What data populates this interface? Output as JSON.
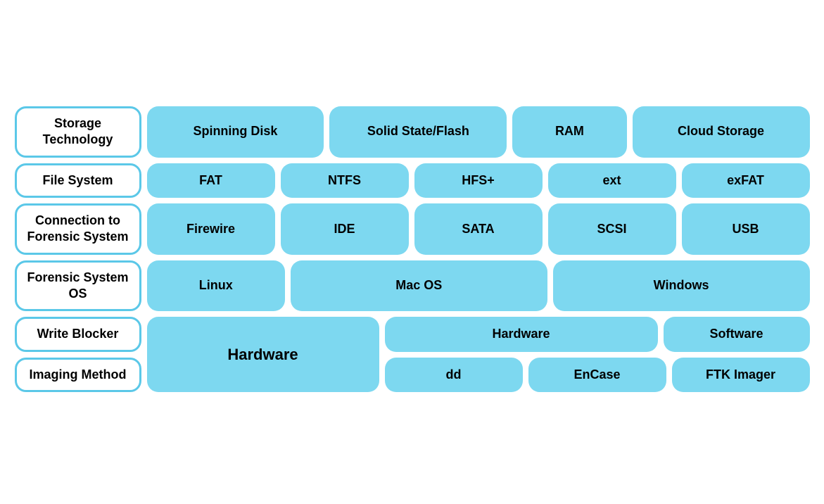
{
  "rows": [
    {
      "id": "row1",
      "label": "Storage Technology",
      "items": [
        "Spinning Disk",
        "Solid State/Flash",
        "RAM",
        "Cloud Storage"
      ]
    },
    {
      "id": "row2",
      "label": "File System",
      "items": [
        "FAT",
        "NTFS",
        "HFS+",
        "ext",
        "exFAT"
      ]
    },
    {
      "id": "row3",
      "label": "Connection to Forensic System",
      "items": [
        "Firewire",
        "IDE",
        "SATA",
        "SCSI",
        "USB"
      ]
    },
    {
      "id": "row4",
      "label": "Forensic System OS",
      "items": [
        "Linux",
        "Mac OS",
        "Windows"
      ]
    }
  ],
  "bottom": {
    "left_label_top": "Write Blocker",
    "left_label_bottom": "Imaging Method",
    "big_cell": "Hardware",
    "right_top_items": [
      "Hardware",
      "Software"
    ],
    "right_bottom_items": [
      "dd",
      "EnCase",
      "FTK Imager"
    ]
  }
}
